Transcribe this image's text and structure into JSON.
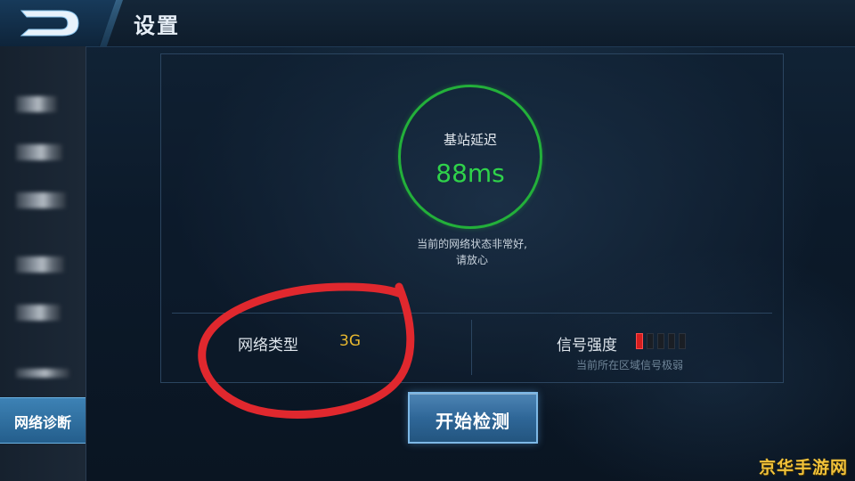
{
  "header": {
    "title": "设置",
    "back_icon": "back-logo-icon"
  },
  "sidebar": {
    "items": [
      {
        "label": "",
        "blurred": true
      },
      {
        "label": "",
        "blurred": true
      },
      {
        "label": "",
        "blurred": true
      },
      {
        "label": "",
        "blurred": true
      },
      {
        "label": "",
        "blurred": true
      },
      {
        "label": "",
        "blurred": true
      },
      {
        "label": "网络诊断",
        "active": true
      }
    ]
  },
  "latency": {
    "label": "基站延迟",
    "value": "88ms",
    "ring_color": "#23b03a"
  },
  "status": {
    "line1": "当前的网络状态非常好,",
    "line2": "请放心"
  },
  "network_type": {
    "label": "网络类型",
    "value": "3G",
    "value_color": "#e7b72f"
  },
  "signal": {
    "label": "信号强度",
    "bars_total": 5,
    "bars_active": 1,
    "active_color": "#d51e1e",
    "note": "当前所在区域信号极弱"
  },
  "start_button": {
    "label": "开始检测"
  },
  "annotation": {
    "shape": "hand-drawn red ellipse",
    "color": "#e0282e"
  },
  "watermark": {
    "text": "京华手游网"
  }
}
